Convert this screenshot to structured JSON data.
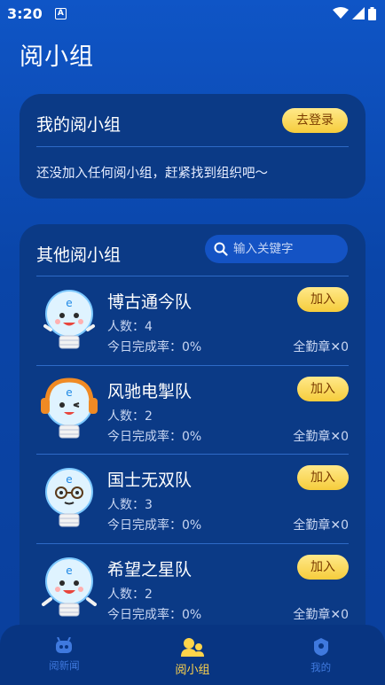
{
  "status": {
    "time": "3:20",
    "a_badge": "A"
  },
  "page": {
    "title": "阅小组"
  },
  "my_group": {
    "title": "我的阅小组",
    "login_label": "去登录",
    "empty_tip": "还没加入任何阅小组，赶紧找到组织吧〜"
  },
  "other_groups": {
    "title": "其他阅小组",
    "search_placeholder": "输入关键字",
    "join_label": "加入",
    "items": [
      {
        "name": "博古通今队",
        "count": "人数：4",
        "rate": "今日完成率：0%",
        "medal": "全勤章✕0",
        "avatar": "bulb-mascot-smile"
      },
      {
        "name": "风驰电掣队",
        "count": "人数：2",
        "rate": "今日完成率：0%",
        "medal": "全勤章✕0",
        "avatar": "bulb-mascot-headphones"
      },
      {
        "name": "国士无双队",
        "count": "人数：3",
        "rate": "今日完成率：0%",
        "medal": "全勤章✕0",
        "avatar": "bulb-mascot-glasses"
      },
      {
        "name": "希望之星队",
        "count": "人数：2",
        "rate": "今日完成率：0%",
        "medal": "全勤章✕0",
        "avatar": "bulb-mascot-cheer"
      }
    ]
  },
  "tabs": [
    {
      "label": "阅新闻",
      "icon": "robot-icon",
      "active": false
    },
    {
      "label": "阅小组",
      "icon": "group-icon",
      "active": true
    },
    {
      "label": "我的",
      "icon": "profile-icon",
      "active": false
    }
  ],
  "colors": {
    "accent": "#ffd44a",
    "card": "#0b3a86",
    "background": "#0f55c6",
    "button": "#f6cd3c"
  }
}
